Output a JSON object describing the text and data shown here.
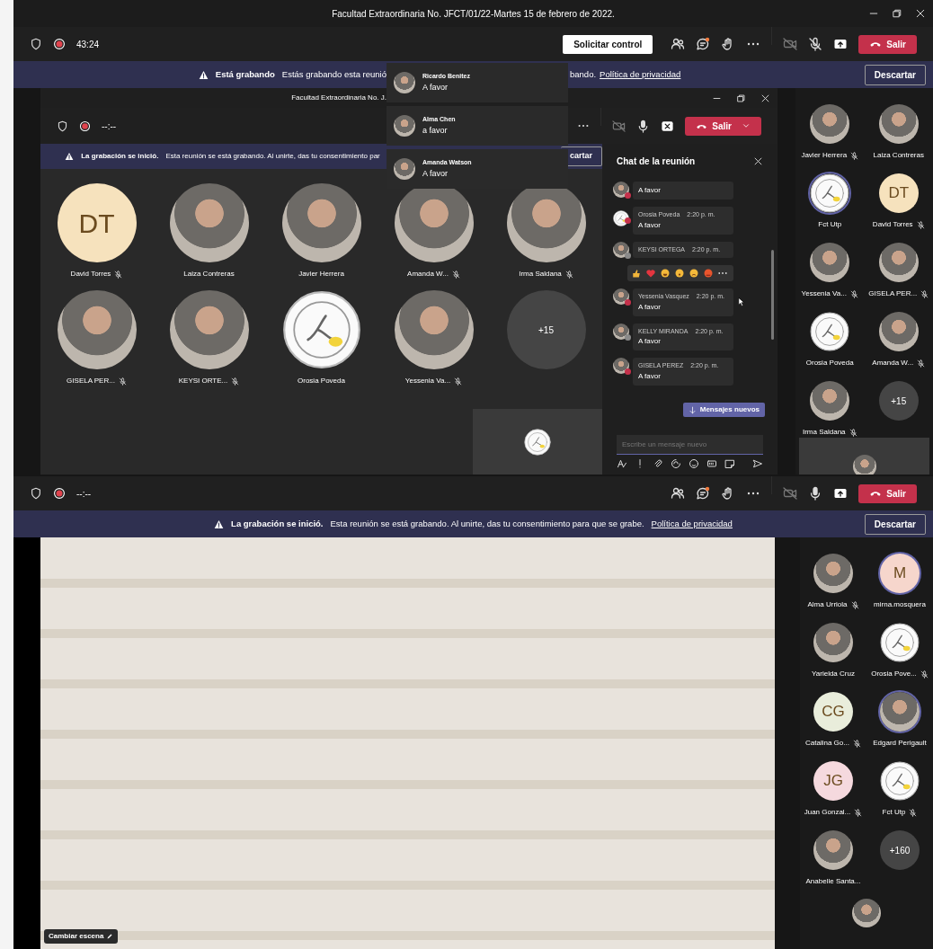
{
  "window": {
    "title": "Facultad Extraordinaria No. JFCT/01/22-Martes 15 de febrero de 2022."
  },
  "top_bar": {
    "timer": "43:24",
    "request_control": "Solicitar control",
    "leave": "Salir"
  },
  "top_banner": {
    "title": "Está grabando",
    "text_before": "Estás grabando esta reunió",
    "text_after": "bando.",
    "link": "Política de privacidad",
    "dismiss": "Descartar"
  },
  "notifications": [
    {
      "name": "Ricardo Benitez",
      "text": "A favor"
    },
    {
      "name": "Alma Chen",
      "text": "a favor"
    },
    {
      "name": "Amanda Watson",
      "text": "A favor"
    }
  ],
  "shared_window": {
    "title": "Facultad Extraordinaria No. J.",
    "timer": "--:--",
    "leave": "Salir",
    "banner": {
      "title": "La grabación se inició.",
      "text": "Esta reunión se está grabando. Al unirte, das tu consentimiento par",
      "dismiss": "cartar"
    },
    "gallery": [
      {
        "kind": "initials",
        "initials": "DT",
        "color": "#f6e2bd",
        "name": "David Torres",
        "muted": true,
        "speaking": false
      },
      {
        "kind": "photo",
        "name": "Laiza Contreras",
        "muted": false,
        "speaking": false
      },
      {
        "kind": "photo",
        "name": "Javier Herrera",
        "muted": false,
        "speaking": false
      },
      {
        "kind": "photo",
        "name": "Amanda W...",
        "muted": true,
        "speaking": false
      },
      {
        "kind": "photo",
        "name": "Irma Saldana",
        "muted": true,
        "speaking": false
      },
      {
        "kind": "photo",
        "name": "GISELA PER...",
        "muted": true,
        "speaking": false
      },
      {
        "kind": "photo",
        "name": "KEYSI ORTE...",
        "muted": true,
        "speaking": false
      },
      {
        "kind": "logo",
        "name": "Orosia Poveda",
        "muted": false,
        "speaking": false
      },
      {
        "kind": "photo",
        "name": "Yessenia Va...",
        "muted": true,
        "speaking": false
      },
      {
        "kind": "more",
        "count": "+15"
      }
    ],
    "chat": {
      "title": "Chat de la reunión",
      "new_messages": "Mensajes nuevos",
      "placeholder": "Escribe un mensaje nuevo",
      "messages": [
        {
          "kind": "photo",
          "text": "A favor",
          "color": "#c4314b",
          "hovered": false
        },
        {
          "kind": "logo",
          "name": "Orosia Poveda",
          "time": "2:20 p. m.",
          "text": "A favor",
          "color": "#c4314b",
          "hovered": false
        },
        {
          "kind": "photo",
          "name": "KEYSI ORTEGA",
          "time": "2:20 p. m.",
          "color": "#8a8a8a",
          "hovered": false
        },
        {
          "kind": "photo",
          "name": "Yessenia Vasquez",
          "time": "2:20 p. m.",
          "text": "A favor",
          "color": "#c4314b",
          "hovered": true
        },
        {
          "kind": "photo",
          "name": "KELLY MIRANDA",
          "time": "2:20 p. m.",
          "text": "A favor",
          "color": "#8a8a8a",
          "hovered": false
        },
        {
          "kind": "photo",
          "name": "GISELA PEREZ",
          "time": "2:20 p. m.",
          "text": "A favor",
          "color": "#c4314b",
          "hovered": false
        }
      ]
    }
  },
  "top_panel": [
    {
      "kind": "photo",
      "name": "Javier Herrera",
      "muted": true,
      "speaking": false
    },
    {
      "kind": "photo",
      "name": "Laiza Contreras",
      "muted": false,
      "speaking": false
    },
    {
      "kind": "logo",
      "name": "Fct Utp",
      "muted": false,
      "speaking": true
    },
    {
      "kind": "initials",
      "initials": "DT",
      "color": "#f6e2bd",
      "name": "David Torres",
      "muted": true,
      "speaking": false
    },
    {
      "kind": "photo",
      "name": "Yessenia Va...",
      "muted": true,
      "speaking": false
    },
    {
      "kind": "photo",
      "name": "GISELA PER...",
      "muted": true,
      "speaking": false
    },
    {
      "kind": "logo",
      "name": "Orosia Poveda",
      "muted": false,
      "speaking": false
    },
    {
      "kind": "photo",
      "name": "Amanda W...",
      "muted": true,
      "speaking": false
    },
    {
      "kind": "photo",
      "name": "Irma Saldana",
      "muted": true,
      "speaking": false
    },
    {
      "kind": "more",
      "count": "+15"
    }
  ],
  "bottom": {
    "timer": "--:--",
    "leave": "Salir",
    "banner": {
      "title": "La grabación se inició.",
      "text": "Esta reunión se está grabando. Al unirte, das tu consentimiento para que se grabe.",
      "link": "Política de privacidad",
      "dismiss": "Descartar"
    },
    "scene_button": "Cambiar escena",
    "panel": [
      {
        "kind": "photo",
        "name": "Alma Urriola",
        "muted": true,
        "speaking": false
      },
      {
        "kind": "initials",
        "initials": "M",
        "color": "#f6d6cc",
        "name": "mirna.mosquera",
        "muted": false,
        "speaking": true
      },
      {
        "kind": "photo",
        "name": "Yarielda Cruz",
        "muted": false,
        "speaking": false
      },
      {
        "kind": "logo",
        "name": "Orosia Pove...",
        "muted": true,
        "speaking": false
      },
      {
        "kind": "initials",
        "initials": "CG",
        "color": "#e9eddb",
        "name": "Catalina Go...",
        "muted": true,
        "speaking": false
      },
      {
        "kind": "photo",
        "name": "Edgard Perigault",
        "muted": false,
        "speaking": true
      },
      {
        "kind": "initials",
        "initials": "JG",
        "color": "#f5d9de",
        "name": "Juan Gonzal...",
        "muted": true,
        "speaking": false
      },
      {
        "kind": "logo",
        "name": "Fct Utp",
        "muted": true,
        "speaking": false
      },
      {
        "kind": "photo",
        "name": "Anabelle Santa...",
        "muted": false,
        "speaking": false
      },
      {
        "kind": "more",
        "count": "+160"
      }
    ]
  }
}
